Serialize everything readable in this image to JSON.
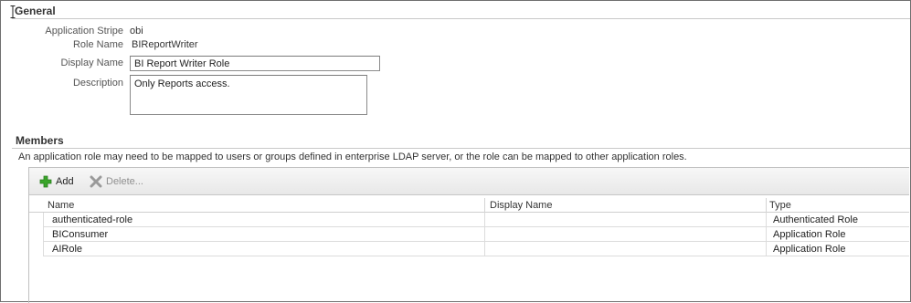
{
  "general": {
    "title": "General",
    "fields": {
      "application_stripe": {
        "label": "Application Stripe",
        "value": "obi"
      },
      "role_name": {
        "label": "Role Name",
        "value": "BIReportWriter"
      },
      "display_name": {
        "label": "Display Name",
        "value": "BI Report Writer Role"
      },
      "description": {
        "label": "Description",
        "value": "Only Reports access."
      }
    }
  },
  "members": {
    "title": "Members",
    "description": "An application role may need to be mapped to users or groups defined in enterprise LDAP server, or the role can be mapped to other application roles.",
    "toolbar": {
      "add_label": "Add",
      "delete_label": "Delete..."
    },
    "columns": {
      "name": "Name",
      "display_name": "Display Name",
      "type": "Type"
    },
    "rows": [
      {
        "name": "authenticated-role",
        "display_name": "",
        "type": "Authenticated Role"
      },
      {
        "name": "BIConsumer",
        "display_name": "",
        "type": "Application Role"
      },
      {
        "name": "AIRole",
        "display_name": "",
        "type": "Application Role"
      }
    ]
  },
  "colors": {
    "add_icon": "#3aa52a",
    "delete_icon": "#9a9a9a",
    "border": "#6f6f6f"
  }
}
